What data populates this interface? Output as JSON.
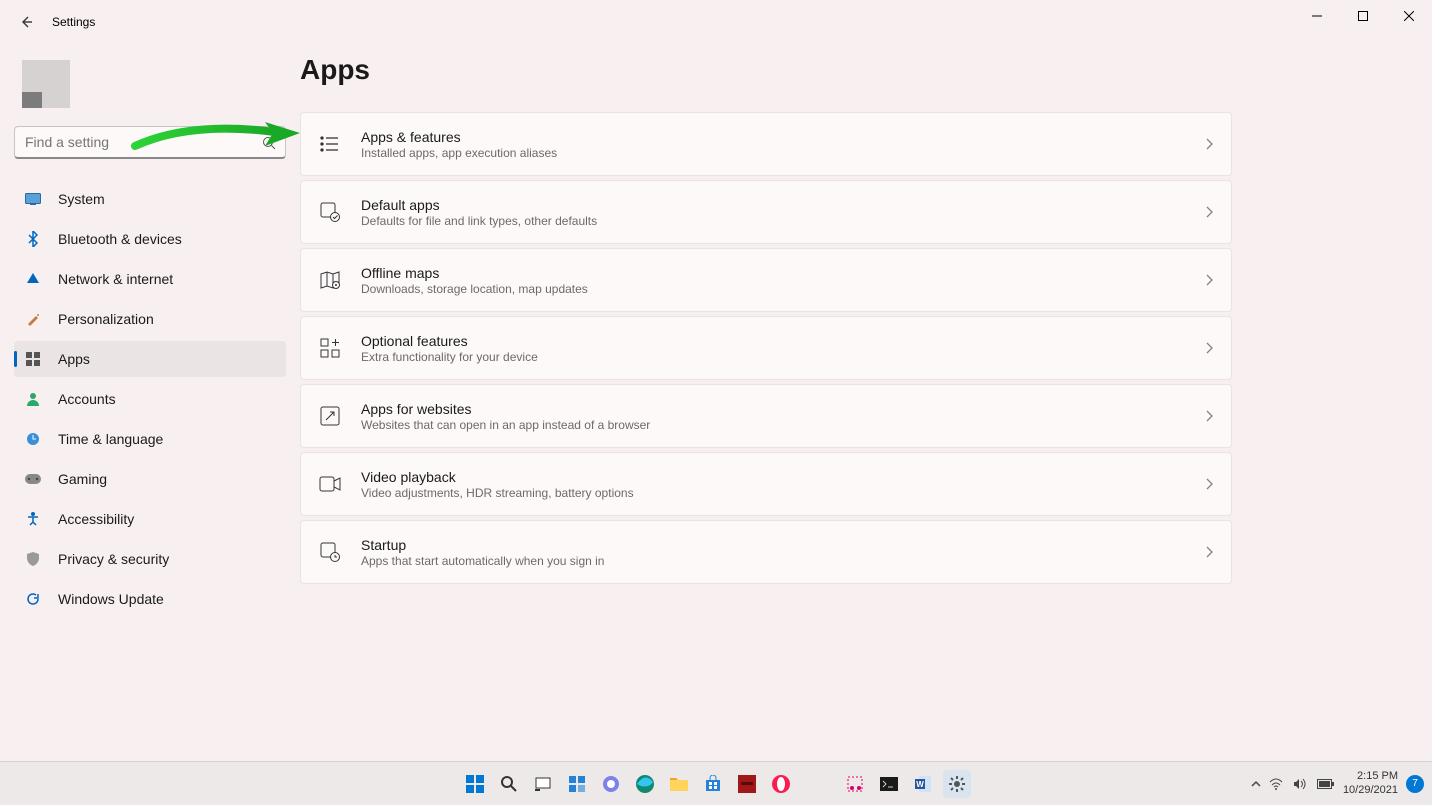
{
  "window": {
    "title": "Settings"
  },
  "search": {
    "placeholder": "Find a setting"
  },
  "page": {
    "title": "Apps"
  },
  "sidebar": {
    "items": [
      {
        "label": "System",
        "icon": "system",
        "color": "#0067c0"
      },
      {
        "label": "Bluetooth & devices",
        "icon": "bluetooth",
        "color": "#0067c0"
      },
      {
        "label": "Network & internet",
        "icon": "network",
        "color": "#0067c0"
      },
      {
        "label": "Personalization",
        "icon": "personalization",
        "color": "#c97b3a"
      },
      {
        "label": "Apps",
        "icon": "apps",
        "color": "#555",
        "active": true
      },
      {
        "label": "Accounts",
        "icon": "accounts",
        "color": "#2aa869"
      },
      {
        "label": "Time & language",
        "icon": "time",
        "color": "#3a8fd6"
      },
      {
        "label": "Gaming",
        "icon": "gaming",
        "color": "#6d6d6d"
      },
      {
        "label": "Accessibility",
        "icon": "accessibility",
        "color": "#0067c0"
      },
      {
        "label": "Privacy & security",
        "icon": "privacy",
        "color": "#8a8a8a"
      },
      {
        "label": "Windows Update",
        "icon": "update",
        "color": "#0067c0"
      }
    ]
  },
  "cards": [
    {
      "title": "Apps & features",
      "sub": "Installed apps, app execution aliases",
      "icon": "list"
    },
    {
      "title": "Default apps",
      "sub": "Defaults for file and link types, other defaults",
      "icon": "default"
    },
    {
      "title": "Offline maps",
      "sub": "Downloads, storage location, map updates",
      "icon": "map"
    },
    {
      "title": "Optional features",
      "sub": "Extra functionality for your device",
      "icon": "plus-grid"
    },
    {
      "title": "Apps for websites",
      "sub": "Websites that can open in an app instead of a browser",
      "icon": "web-app"
    },
    {
      "title": "Video playback",
      "sub": "Video adjustments, HDR streaming, battery options",
      "icon": "video"
    },
    {
      "title": "Startup",
      "sub": "Apps that start automatically when you sign in",
      "icon": "startup"
    }
  ],
  "taskbar": {
    "time": "2:15 PM",
    "date": "10/29/2021",
    "notifications": "7"
  }
}
